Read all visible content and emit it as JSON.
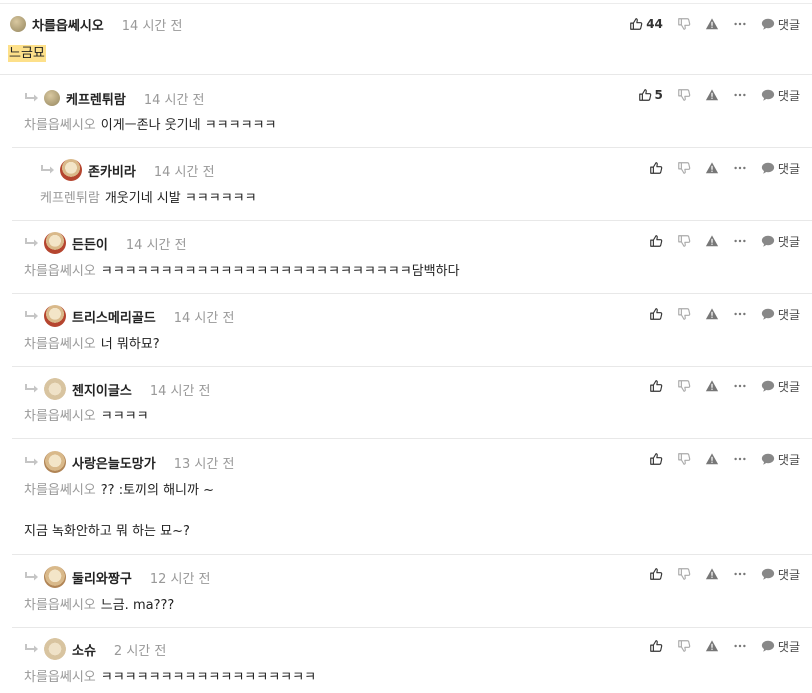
{
  "comments": [
    {
      "nick": "차를읍쎄시오",
      "time": "14 시간 전",
      "avatar": "ball-avatar",
      "mention": "",
      "text": "느금묘",
      "highlight": true,
      "likes": "44"
    },
    {
      "nick": "케프렌튀람",
      "time": "14 시간 전",
      "avatar": "ball-avatar",
      "mention": "차를읍쎄시오",
      "text": "이게ㅡ존나 웃기네 ㅋㅋㅋㅋㅋㅋ",
      "likes": "5"
    },
    {
      "nick": "존카비라",
      "time": "14 시간 전",
      "avatar": "dog-avatar",
      "mention": "케프렌튀람",
      "text": "개웃기네 시발 ㅋㅋㅋㅋㅋㅋ",
      "likes": ""
    },
    {
      "nick": "든든이",
      "time": "14 시간 전",
      "avatar": "dog-avatar",
      "mention": "차를읍쎄시오",
      "text": "ㅋㅋㅋㅋㅋㅋㅋㅋㅋㅋㅋㅋㅋㅋㅋㅋㅋㅋㅋㅋㅋㅋㅋㅋㅋㅋ담백하다",
      "likes": ""
    },
    {
      "nick": "트리스메리골드",
      "time": "14 시간 전",
      "avatar": "dog-avatar",
      "mention": "차를읍쎄시오",
      "text": "너 뭐하묘?",
      "likes": ""
    },
    {
      "nick": "젠지이글스",
      "time": "14 시간 전",
      "avatar": "dog-avatar",
      "mention": "차를읍쎄시오",
      "text": "ㅋㅋㅋㅋ",
      "likes": ""
    },
    {
      "nick": "사랑은늘도망가",
      "time": "13 시간 전",
      "avatar": "dog-avatar",
      "mention": "차를읍쎄시오",
      "text": "?? :토끼의 해니까 ~",
      "text2": "지금 녹화안하고 뭐 하는 묘~?",
      "likes": ""
    },
    {
      "nick": "둘리와짱구",
      "time": "12 시간 전",
      "avatar": "dog-avatar",
      "mention": "차를읍쎄시오",
      "text": "느금. ma???",
      "likes": ""
    },
    {
      "nick": "소슈",
      "time": "2 시간 전",
      "avatar": "dog-avatar",
      "mention": "차를읍쎄시오",
      "text": "ㅋㅋㅋㅋㅋㅋㅋㅋㅋㅋㅋㅋㅋㅋㅋㅋㅋㅋ",
      "likes": ""
    }
  ],
  "actions": {
    "reply_label": "댓글",
    "icons": [
      "thumbs-up-icon",
      "thumbs-down-icon",
      "report-warning-icon",
      "more-dots-icon",
      "reply-bubble-icon"
    ]
  },
  "colors": {
    "highlight": "#fde08a",
    "muted": "#999999",
    "divider": "#e8e8e8"
  }
}
